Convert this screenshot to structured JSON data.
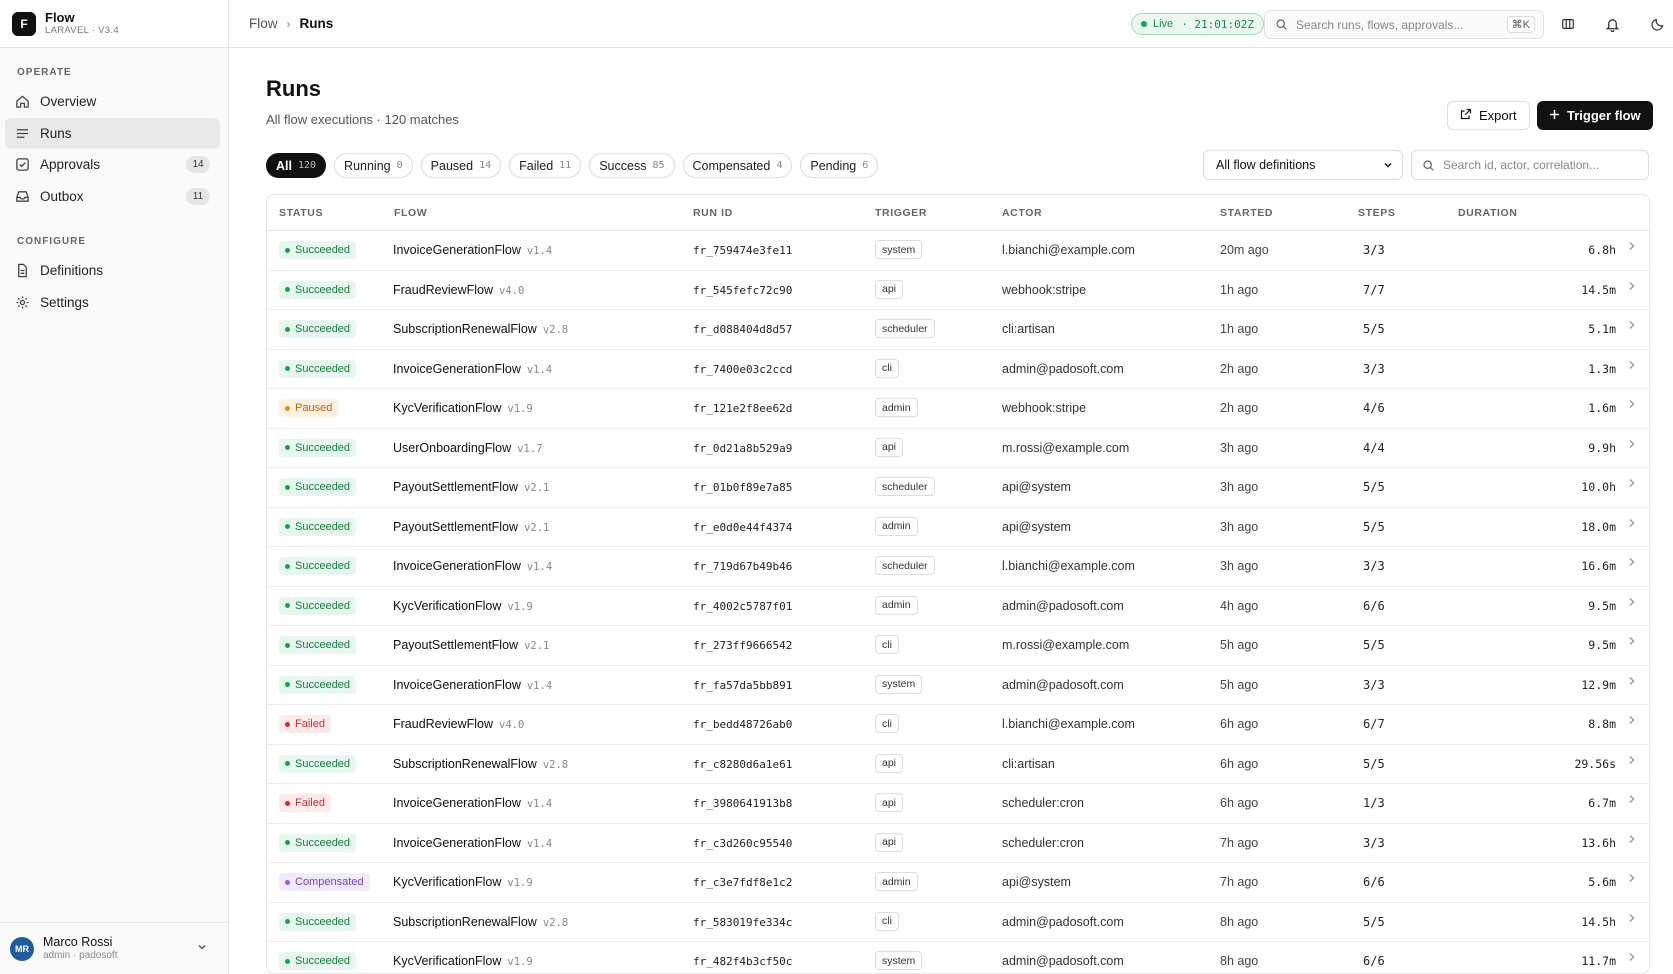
{
  "brand": {
    "logo": "F",
    "name": "Flow",
    "sub": "LARAVEL · V3.4"
  },
  "sidebar": {
    "operate_title": "OPERATE",
    "configure_title": "CONFIGURE",
    "operate": [
      {
        "label": "Overview",
        "icon": "home-icon"
      },
      {
        "label": "Runs",
        "icon": "list-icon",
        "active": true
      },
      {
        "label": "Approvals",
        "icon": "check-square-icon",
        "count": "14"
      },
      {
        "label": "Outbox",
        "icon": "inbox-icon",
        "count": "11"
      }
    ],
    "configure": [
      {
        "label": "Definitions",
        "icon": "file-icon"
      },
      {
        "label": "Settings",
        "icon": "gear-icon"
      }
    ],
    "user": {
      "initials": "MR",
      "name": "Marco Rossi",
      "sub": "admin · padosoft"
    }
  },
  "header": {
    "crumb_root": "Flow",
    "crumb_current": "Runs",
    "live_label": "Live",
    "live_time": "· 21:01:02Z",
    "search_placeholder": "Search runs, flows, approvals...",
    "search_kbd": "⌘K"
  },
  "page": {
    "title": "Runs",
    "subtitle": "All flow executions · 120 matches",
    "export_label": "Export",
    "trigger_label": "Trigger flow"
  },
  "filters": {
    "chips": [
      {
        "label": "All",
        "count": "120",
        "active": true
      },
      {
        "label": "Running",
        "count": "0"
      },
      {
        "label": "Paused",
        "count": "14"
      },
      {
        "label": "Failed",
        "count": "11"
      },
      {
        "label": "Success",
        "count": "85"
      },
      {
        "label": "Compensated",
        "count": "4"
      },
      {
        "label": "Pending",
        "count": "6"
      }
    ],
    "definition_select": "All flow definitions",
    "id_search_placeholder": "Search id, actor, correlation..."
  },
  "table": {
    "headers": {
      "status": "STATUS",
      "flow": "FLOW",
      "run_id": "RUN ID",
      "trigger": "TRIGGER",
      "actor": "ACTOR",
      "started": "STARTED",
      "steps": "STEPS",
      "duration": "DURATION"
    },
    "rows": [
      {
        "status": "Succeeded",
        "flow": "InvoiceGenerationFlow",
        "version": "v1.4",
        "run_id": "fr_759474e3fe11",
        "trigger": "system",
        "actor": "l.bianchi@example.com",
        "started": "20m ago",
        "steps": "3/3",
        "duration": "6.8h"
      },
      {
        "status": "Succeeded",
        "flow": "FraudReviewFlow",
        "version": "v4.0",
        "run_id": "fr_545fefc72c90",
        "trigger": "api",
        "actor": "webhook:stripe",
        "started": "1h ago",
        "steps": "7/7",
        "duration": "14.5m"
      },
      {
        "status": "Succeeded",
        "flow": "SubscriptionRenewalFlow",
        "version": "v2.8",
        "run_id": "fr_d088404d8d57",
        "trigger": "scheduler",
        "actor": "cli:artisan",
        "started": "1h ago",
        "steps": "5/5",
        "duration": "5.1m"
      },
      {
        "status": "Succeeded",
        "flow": "InvoiceGenerationFlow",
        "version": "v1.4",
        "run_id": "fr_7400e03c2ccd",
        "trigger": "cli",
        "actor": "admin@padosoft.com",
        "started": "2h ago",
        "steps": "3/3",
        "duration": "1.3m"
      },
      {
        "status": "Paused",
        "flow": "KycVerificationFlow",
        "version": "v1.9",
        "run_id": "fr_121e2f8ee62d",
        "trigger": "admin",
        "actor": "webhook:stripe",
        "started": "2h ago",
        "steps": "4/6",
        "duration": "1.6m"
      },
      {
        "status": "Succeeded",
        "flow": "UserOnboardingFlow",
        "version": "v1.7",
        "run_id": "fr_0d21a8b529a9",
        "trigger": "api",
        "actor": "m.rossi@example.com",
        "started": "3h ago",
        "steps": "4/4",
        "duration": "9.9h"
      },
      {
        "status": "Succeeded",
        "flow": "PayoutSettlementFlow",
        "version": "v2.1",
        "run_id": "fr_01b0f89e7a85",
        "trigger": "scheduler",
        "actor": "api@system",
        "started": "3h ago",
        "steps": "5/5",
        "duration": "10.0h"
      },
      {
        "status": "Succeeded",
        "flow": "PayoutSettlementFlow",
        "version": "v2.1",
        "run_id": "fr_e0d0e44f4374",
        "trigger": "admin",
        "actor": "api@system",
        "started": "3h ago",
        "steps": "5/5",
        "duration": "18.0m"
      },
      {
        "status": "Succeeded",
        "flow": "InvoiceGenerationFlow",
        "version": "v1.4",
        "run_id": "fr_719d67b49b46",
        "trigger": "scheduler",
        "actor": "l.bianchi@example.com",
        "started": "3h ago",
        "steps": "3/3",
        "duration": "16.6m"
      },
      {
        "status": "Succeeded",
        "flow": "KycVerificationFlow",
        "version": "v1.9",
        "run_id": "fr_4002c5787f01",
        "trigger": "admin",
        "actor": "admin@padosoft.com",
        "started": "4h ago",
        "steps": "6/6",
        "duration": "9.5m"
      },
      {
        "status": "Succeeded",
        "flow": "PayoutSettlementFlow",
        "version": "v2.1",
        "run_id": "fr_273ff9666542",
        "trigger": "cli",
        "actor": "m.rossi@example.com",
        "started": "5h ago",
        "steps": "5/5",
        "duration": "9.5m"
      },
      {
        "status": "Succeeded",
        "flow": "InvoiceGenerationFlow",
        "version": "v1.4",
        "run_id": "fr_fa57da5bb891",
        "trigger": "system",
        "actor": "admin@padosoft.com",
        "started": "5h ago",
        "steps": "3/3",
        "duration": "12.9m"
      },
      {
        "status": "Failed",
        "flow": "FraudReviewFlow",
        "version": "v4.0",
        "run_id": "fr_bedd48726ab0",
        "trigger": "cli",
        "actor": "l.bianchi@example.com",
        "started": "6h ago",
        "steps": "6/7",
        "duration": "8.8m"
      },
      {
        "status": "Succeeded",
        "flow": "SubscriptionRenewalFlow",
        "version": "v2.8",
        "run_id": "fr_c8280d6a1e61",
        "trigger": "api",
        "actor": "cli:artisan",
        "started": "6h ago",
        "steps": "5/5",
        "duration": "29.56s"
      },
      {
        "status": "Failed",
        "flow": "InvoiceGenerationFlow",
        "version": "v1.4",
        "run_id": "fr_3980641913b8",
        "trigger": "api",
        "actor": "scheduler:cron",
        "started": "6h ago",
        "steps": "1/3",
        "duration": "6.7m"
      },
      {
        "status": "Succeeded",
        "flow": "InvoiceGenerationFlow",
        "version": "v1.4",
        "run_id": "fr_c3d260c95540",
        "trigger": "api",
        "actor": "scheduler:cron",
        "started": "7h ago",
        "steps": "3/3",
        "duration": "13.6h"
      },
      {
        "status": "Compensated",
        "flow": "KycVerificationFlow",
        "version": "v1.9",
        "run_id": "fr_c3e7fdf8e1c2",
        "trigger": "admin",
        "actor": "api@system",
        "started": "7h ago",
        "steps": "6/6",
        "duration": "5.6m"
      },
      {
        "status": "Succeeded",
        "flow": "SubscriptionRenewalFlow",
        "version": "v2.8",
        "run_id": "fr_583019fe334c",
        "trigger": "cli",
        "actor": "admin@padosoft.com",
        "started": "8h ago",
        "steps": "5/5",
        "duration": "14.5h"
      },
      {
        "status": "Succeeded",
        "flow": "KycVerificationFlow",
        "version": "v1.9",
        "run_id": "fr_482f4b3cf50c",
        "trigger": "system",
        "actor": "admin@padosoft.com",
        "started": "8h ago",
        "steps": "6/6",
        "duration": "11.7m"
      }
    ]
  },
  "colors": {
    "accent": "#111111",
    "succeeded": "#16a34a",
    "paused": "#ea8a14",
    "failed": "#dc2626",
    "compensated": "#8b5cf6",
    "live": "#1aa35f"
  }
}
